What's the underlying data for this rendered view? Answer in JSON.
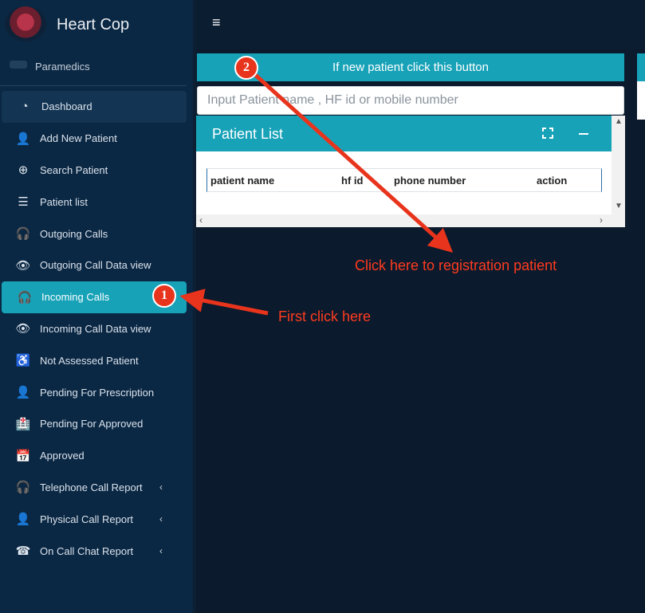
{
  "brand": {
    "title": "Heart Cop"
  },
  "user": {
    "role": "Paramedics"
  },
  "sidebar": {
    "items": [
      {
        "label": "Dashboard",
        "icon": "dashboard-icon",
        "glyph": "◔",
        "chevron": false
      },
      {
        "label": "Add New Patient",
        "icon": "user-plus-icon",
        "glyph": "👤",
        "chevron": false
      },
      {
        "label": "Search Patient",
        "icon": "search-plus-icon",
        "glyph": "⊕",
        "chevron": false
      },
      {
        "label": "Patient list",
        "icon": "list-icon",
        "glyph": "☰",
        "chevron": false
      },
      {
        "label": "Outgoing Calls",
        "icon": "headset-icon",
        "glyph": "🎧",
        "chevron": false
      },
      {
        "label": "Outgoing Call Data view",
        "icon": "eye-icon",
        "glyph": "👁",
        "chevron": false
      },
      {
        "label": "Incoming Calls",
        "icon": "headset-icon",
        "glyph": "🎧",
        "chevron": false
      },
      {
        "label": "Incoming Call Data view",
        "icon": "eye-icon",
        "glyph": "👁",
        "chevron": false
      },
      {
        "label": "Not Assessed Patient",
        "icon": "wheelchair-icon",
        "glyph": "♿",
        "chevron": false
      },
      {
        "label": "Pending For Prescription",
        "icon": "user-doctor-icon",
        "glyph": "👤",
        "chevron": false
      },
      {
        "label": "Pending For Approved",
        "icon": "hospital-user-icon",
        "glyph": "🏥",
        "chevron": false
      },
      {
        "label": "Approved",
        "icon": "calendar-check-icon",
        "glyph": "📅",
        "chevron": false
      },
      {
        "label": "Telephone Call Report",
        "icon": "headset-icon",
        "glyph": "🎧",
        "chevron": true
      },
      {
        "label": "Physical Call Report",
        "icon": "user-icon",
        "glyph": "👤",
        "chevron": true
      },
      {
        "label": "On Call Chat Report",
        "icon": "phone-square-icon",
        "glyph": "☎",
        "chevron": true
      }
    ],
    "chevron_glyph": "‹"
  },
  "topbar": {
    "menu_glyph": "≡"
  },
  "main": {
    "new_patient_button": "If new patient click this button",
    "search_placeholder": "Input Patient name , HF id or mobile number",
    "patient_list": {
      "title": "Patient List",
      "columns": [
        "patient name",
        "hf id",
        "phone number",
        "action"
      ]
    }
  },
  "annotations": {
    "step1_number": "1",
    "step1_text": "First click here",
    "step2_number": "2",
    "step2_text": "Click here to registration patient"
  },
  "colors": {
    "sidebar": "#0a2743",
    "accent": "#17a2b8",
    "background": "#0b1a2c",
    "annotation": "#e8341c"
  }
}
